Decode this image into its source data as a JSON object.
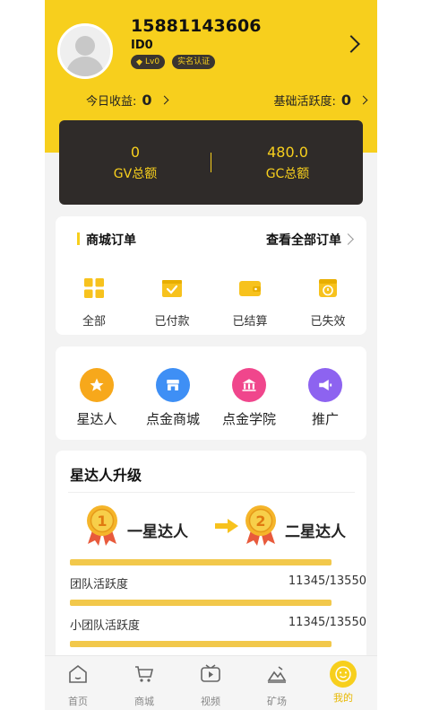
{
  "profile": {
    "phone": "15881143606",
    "id_label": "ID0",
    "level_badge": "Lv0",
    "verify_badge": "实名认证"
  },
  "earnings": {
    "today_label": "今日收益:",
    "today_value": "0",
    "activity_label": "基础活跃度:",
    "activity_value": "0"
  },
  "wallet": {
    "gv_value": "0",
    "gv_label": "GV总额",
    "gc_value": "480.0",
    "gc_label": "GC总额"
  },
  "orders": {
    "title": "商城订单",
    "view_all": "查看全部订单",
    "items": [
      {
        "label": "全部",
        "icon": "grid-icon"
      },
      {
        "label": "已付款",
        "icon": "paid-icon"
      },
      {
        "label": "已结算",
        "icon": "wallet-icon"
      },
      {
        "label": "已失效",
        "icon": "expired-icon"
      }
    ]
  },
  "shortcuts": {
    "items": [
      {
        "label": "星达人",
        "icon": "star-icon",
        "color": "#f7a81b"
      },
      {
        "label": "点金商城",
        "icon": "store-icon",
        "color": "#3e8ff5"
      },
      {
        "label": "点金学院",
        "icon": "academy-icon",
        "color": "#f0468c"
      },
      {
        "label": "推广",
        "icon": "megaphone-icon",
        "color": "#8d63f0"
      }
    ]
  },
  "upgrade": {
    "title": "星达人升级",
    "from_level": "一星达人",
    "to_level": "二星达人",
    "from_num": "1",
    "to_num": "2",
    "rows": [
      {
        "label": "团队活跃度",
        "value": "11345/13550"
      },
      {
        "label": "小团队活跃度",
        "value": "11345/13550"
      }
    ]
  },
  "tabbar": {
    "items": [
      {
        "label": "首页",
        "icon": "home-icon"
      },
      {
        "label": "商城",
        "icon": "cart-icon"
      },
      {
        "label": "视频",
        "icon": "video-icon"
      },
      {
        "label": "矿场",
        "icon": "mine-icon"
      },
      {
        "label": "我的",
        "icon": "smile-icon"
      }
    ]
  },
  "colors": {
    "accent": "#f7cf1d",
    "dark": "#2f2b29"
  }
}
